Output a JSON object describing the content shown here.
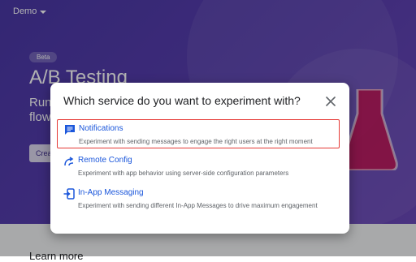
{
  "project": {
    "name": "Demo"
  },
  "hero": {
    "badge": "Beta",
    "title": "A/B Testing",
    "subtitle_line1": "Run",
    "subtitle_line2": "flow",
    "button_label": "Crea"
  },
  "below": {
    "learn_more": "Learn more"
  },
  "dialog": {
    "title": "Which service do you want to experiment with?",
    "options": [
      {
        "title": "Notifications",
        "description": "Experiment with sending messages to engage the right users at the right moment",
        "icon": "notification-message-icon",
        "selected": true
      },
      {
        "title": "Remote Config",
        "description": "Experiment with app behavior using server-side configuration parameters",
        "icon": "remote-config-icon",
        "selected": false
      },
      {
        "title": "In-App Messaging",
        "description": "Experiment with sending different In-App Messages to drive maximum engagement",
        "icon": "in-app-messaging-icon",
        "selected": false
      }
    ]
  },
  "colors": {
    "hero": "#5a3fb0",
    "accent": "#1a56db",
    "selection": "#e53935"
  }
}
